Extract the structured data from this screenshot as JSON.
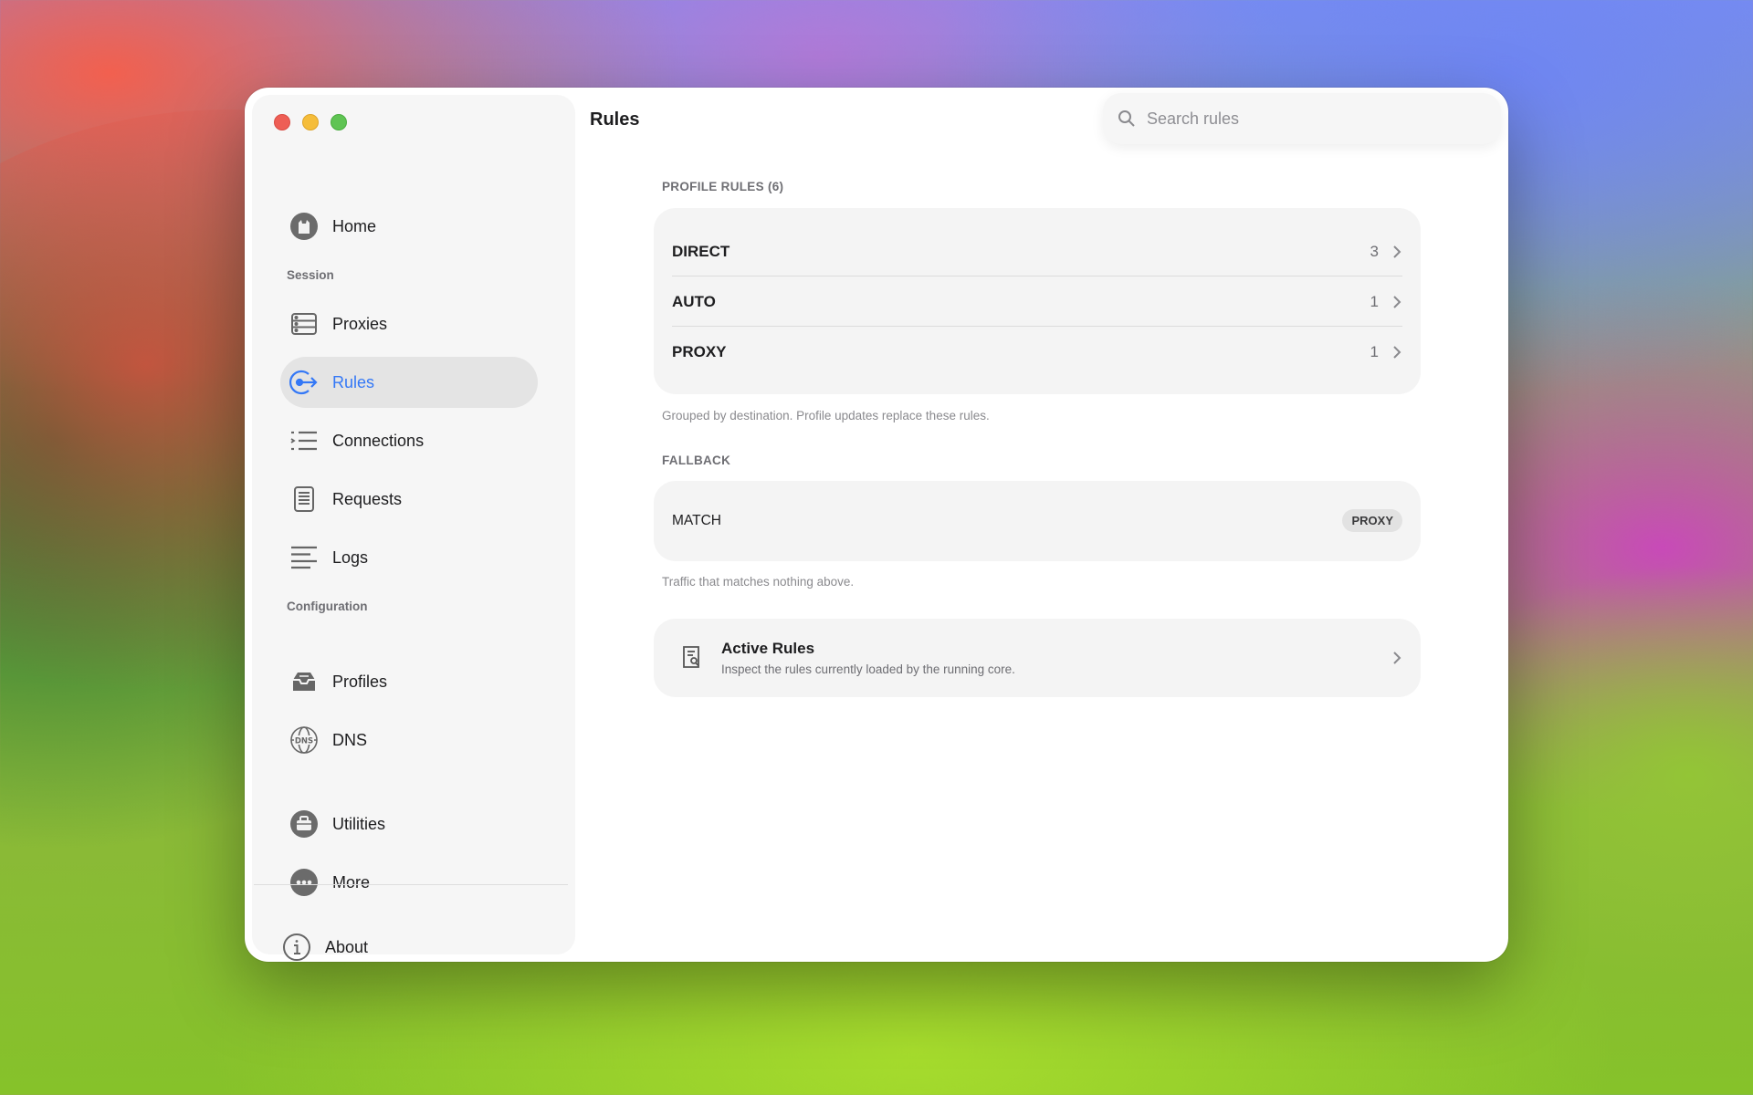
{
  "sidebar": {
    "home": "Home",
    "session_label": "Session",
    "proxies": "Proxies",
    "rules": "Rules",
    "connections": "Connections",
    "requests": "Requests",
    "logs": "Logs",
    "configuration_label": "Configuration",
    "profiles": "Profiles",
    "dns": "DNS",
    "utilities": "Utilities",
    "more": "More",
    "about": "About",
    "active_item": "Rules"
  },
  "header": {
    "title": "Rules",
    "search_placeholder": "Search rules"
  },
  "profile_rules": {
    "heading": "PROFILE RULES (6)",
    "rows": [
      {
        "name": "DIRECT",
        "count": "3"
      },
      {
        "name": "AUTO",
        "count": "1"
      },
      {
        "name": "PROXY",
        "count": "1"
      }
    ],
    "footnote": "Grouped by destination. Profile updates replace these rules."
  },
  "fallback": {
    "heading": "FALLBACK",
    "rule": "MATCH",
    "target": "PROXY",
    "footnote": "Traffic that matches nothing above."
  },
  "active_rules": {
    "title": "Active Rules",
    "subtitle": "Inspect the rules currently loaded by the running core."
  },
  "colors": {
    "accent": "#3478f6",
    "close": "#ee5e55",
    "minimize": "#f5bd3a",
    "zoom": "#5fc453"
  }
}
